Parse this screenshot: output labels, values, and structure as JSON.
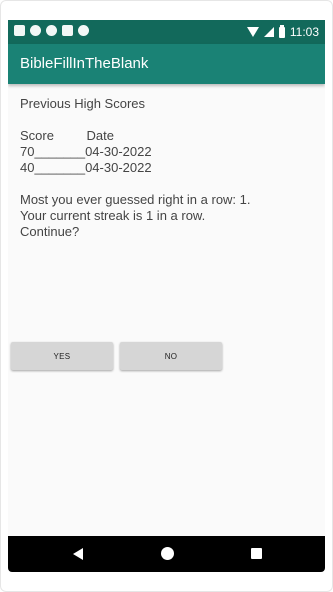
{
  "status_bar": {
    "time": "11:03",
    "left_icons": [
      "notification-a-icon",
      "play-protect-icon",
      "shield-icon",
      "sd-card-icon",
      "record-icon"
    ],
    "right_icons": [
      "wifi-icon",
      "cell-signal-icon",
      "battery-icon"
    ]
  },
  "app_bar": {
    "title": "BibleFillInTheBlank"
  },
  "content": {
    "heading": "Previous High Scores",
    "score_header": "Score         Date",
    "scores": [
      "70_______04-30-2022",
      "40_______04-30-2022"
    ],
    "message": "Most you ever guessed right in a row: 1. Your current streak is 1 in a row.  Continue?"
  },
  "buttons": {
    "yes": "YES",
    "no": "NO"
  },
  "nav_bar": {
    "icons": [
      "back-icon",
      "home-icon",
      "recents-icon"
    ]
  },
  "colors": {
    "status_bar": "#12695b",
    "app_bar": "#1a8275",
    "button": "#d6d6d6"
  }
}
